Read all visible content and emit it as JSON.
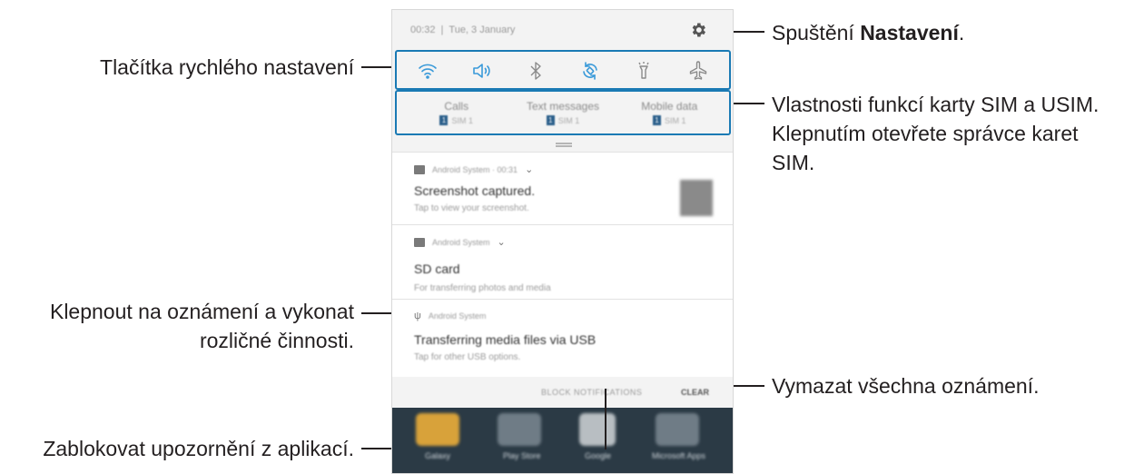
{
  "callouts": {
    "quick_settings": "Tlačítka rychlého nastavení",
    "settings_prefix": "Spuštění ",
    "settings_bold": "Nastavení",
    "settings_suffix": ".",
    "sim_line1": "Vlastnosti funkcí karty SIM a USIM.",
    "sim_line2": "Klepnutím otevřete správce karet",
    "sim_line3": "SIM.",
    "notif_line1": "Klepnout na oznámení a vykonat",
    "notif_line2": "rozličné činnosti.",
    "clear_all": "Vymazat všechna oznámení.",
    "block": "Zablokovat upozornění z aplikací."
  },
  "phone": {
    "status": {
      "time": "00:32",
      "date": "Tue, 3 January"
    },
    "quick_settings_icons": [
      "wifi-icon",
      "sound-icon",
      "bluetooth-icon",
      "auto-rotate-icon",
      "flashlight-icon",
      "airplane-mode-icon"
    ],
    "sim": [
      {
        "title": "Calls",
        "badge": "1",
        "label": "SIM 1"
      },
      {
        "title": "Text messages",
        "badge": "1",
        "label": "SIM 1"
      },
      {
        "title": "Mobile data",
        "badge": "1",
        "label": "SIM 1"
      }
    ],
    "notifications": [
      {
        "app": "Android System · 00:31",
        "title": "Screenshot captured.",
        "desc": "Tap to view your screenshot."
      },
      {
        "app": "Android System",
        "title": "SD card",
        "desc": "For transferring photos and media"
      },
      {
        "app": "Android System",
        "title": "Transferring media files via USB",
        "desc": "Tap for other USB options."
      }
    ],
    "actions": {
      "block": "BLOCK NOTIFICATIONS",
      "clear": "CLEAR"
    },
    "home_apps": [
      "Galaxy",
      "Play Store",
      "Google",
      "Microsoft Apps"
    ]
  },
  "colors": {
    "highlight": "#1a7ab4",
    "callout_text": "#231f20",
    "homescreen": "#2b3a45"
  }
}
